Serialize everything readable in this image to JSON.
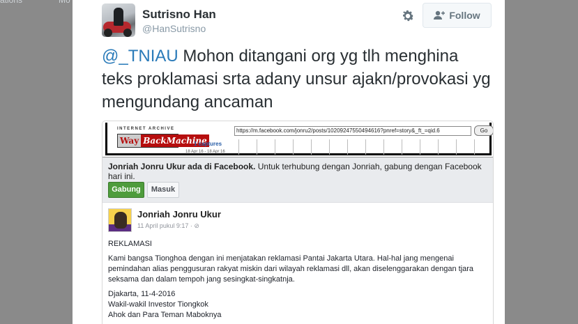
{
  "background_nav": {
    "left_label": "ations",
    "right_label": "Mo"
  },
  "author": {
    "name": "Sutrisno Han",
    "handle": "@HanSutrisno"
  },
  "actions": {
    "follow_label": "Follow"
  },
  "tweet": {
    "mention": "@_TNIAU",
    "text": " Mohon ditangani org yg tlh menghina teks proklamasi srta adany unsur ajakn/provokasi yg mengundang ancaman"
  },
  "wayback": {
    "logo_top": "INTERNET ARCHIVE",
    "logo_way": "Way",
    "logo_machine": "BackMachine",
    "url": "https://m.facebook.com/jonru2/posts/10209247550494616?pnref=story&_ft_=qid.6",
    "go_label": "Go",
    "captures": "1 captures",
    "dates": "18 Apr 16 - 18 Apr 16"
  },
  "facebook": {
    "notice_bold": "Jonriah Jonru Ukur ada di Facebook.",
    "notice_rest": " Untuk terhubung dengan Jonriah, gabung dengan Facebook hari ini.",
    "join_label": "Gabung",
    "login_label": "Masuk",
    "post": {
      "author": "Jonriah Jonru Ukur",
      "time": "11 April pukul 9:17 · ⊘",
      "title": "REKLAMASI",
      "paragraph": "Kami bangsa Tionghoa dengan ini menjatakan reklamasi Pantai Jakarta Utara. Hal-hal jang mengenai pemindahan alias penggusuran rakyat miskin dari wilayah reklamasi dll, akan diselenggarakan dengan tjara seksama dan dalam tempoh jang sesingkat-singkatnja.",
      "place_date": "Djakarta, 11-4-2016",
      "sign1": "Wakil-wakil Investor Tiongkok",
      "sign2": "Ahok dan Para Teman Maboknya"
    }
  },
  "colors": {
    "mention": "#2b7bb9",
    "name": "#292f33",
    "handle": "#8899a6",
    "fb_green": "#4e9c3c"
  }
}
